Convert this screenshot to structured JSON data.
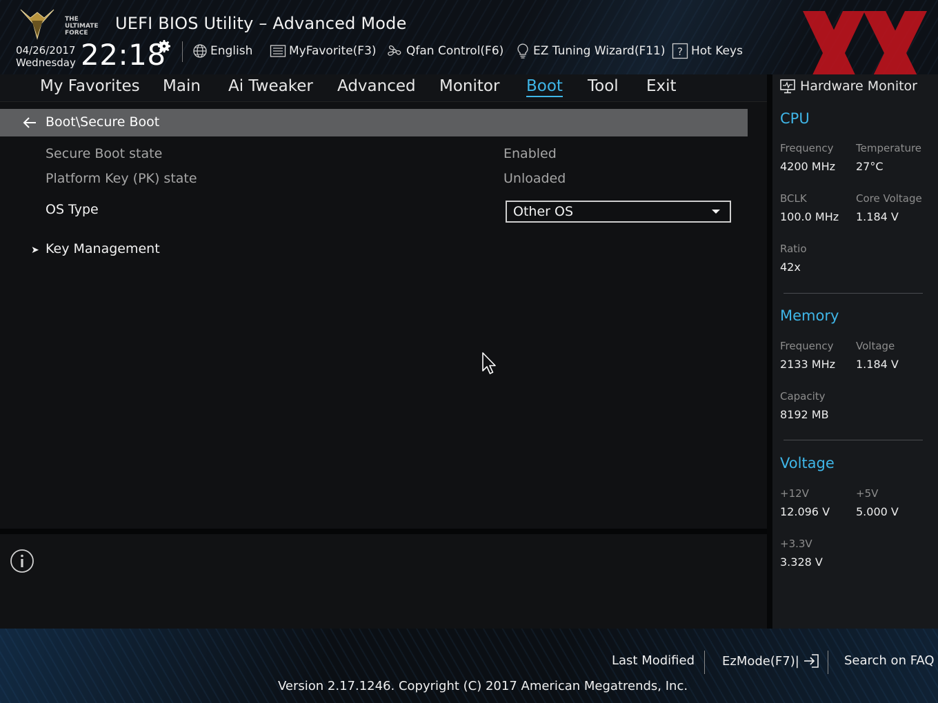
{
  "header": {
    "logo_text": "THE ULTIMATE FORCE",
    "title": "UEFI BIOS Utility – Advanced Mode",
    "date": "04/26/2017",
    "weekday": "Wednesday",
    "time": "22:18",
    "tools": {
      "language": "English",
      "favorite": "MyFavorite(F3)",
      "qfan": "Qfan Control(F6)",
      "ez_tuning": "EZ Tuning Wizard(F11)",
      "hotkeys": "Hot Keys"
    }
  },
  "menu": {
    "tabs": [
      "My Favorites",
      "Main",
      "Ai Tweaker",
      "Advanced",
      "Monitor",
      "Boot",
      "Tool",
      "Exit"
    ],
    "active": "Boot"
  },
  "main": {
    "breadcrumb": "Boot\\Secure Boot",
    "secure_boot_state": {
      "label": "Secure Boot state",
      "value": "Enabled"
    },
    "pk_state": {
      "label": "Platform Key (PK) state",
      "value": "Unloaded"
    },
    "os_type": {
      "label": "OS Type",
      "value": "Other OS"
    },
    "key_management": "Key Management"
  },
  "hardware_monitor": {
    "title": "Hardware Monitor",
    "cpu": {
      "heading": "CPU",
      "frequency_label": "Frequency",
      "frequency": "4200 MHz",
      "temperature_label": "Temperature",
      "temperature": "27°C",
      "bclk_label": "BCLK",
      "bclk": "100.0 MHz",
      "core_voltage_label": "Core Voltage",
      "core_voltage": "1.184 V",
      "ratio_label": "Ratio",
      "ratio": "42x"
    },
    "memory": {
      "heading": "Memory",
      "frequency_label": "Frequency",
      "frequency": "2133 MHz",
      "voltage_label": "Voltage",
      "voltage": "1.184 V",
      "capacity_label": "Capacity",
      "capacity": "8192 MB"
    },
    "voltage": {
      "heading": "Voltage",
      "v12_label": "+12V",
      "v12": "12.096 V",
      "v5_label": "+5V",
      "v5": "5.000 V",
      "v33_label": "+3.3V",
      "v33": "3.328 V"
    }
  },
  "footer": {
    "last_modified": "Last Modified",
    "ezmode": "EzMode(F7)|",
    "search_faq": "Search on FAQ",
    "version": "Version 2.17.1246. Copyright (C) 2017 American Megatrends, Inc."
  },
  "colors": {
    "accent": "#3fb6e8",
    "breadcrumb_bg": "#5d5e60",
    "watermark": "#c8141e"
  }
}
